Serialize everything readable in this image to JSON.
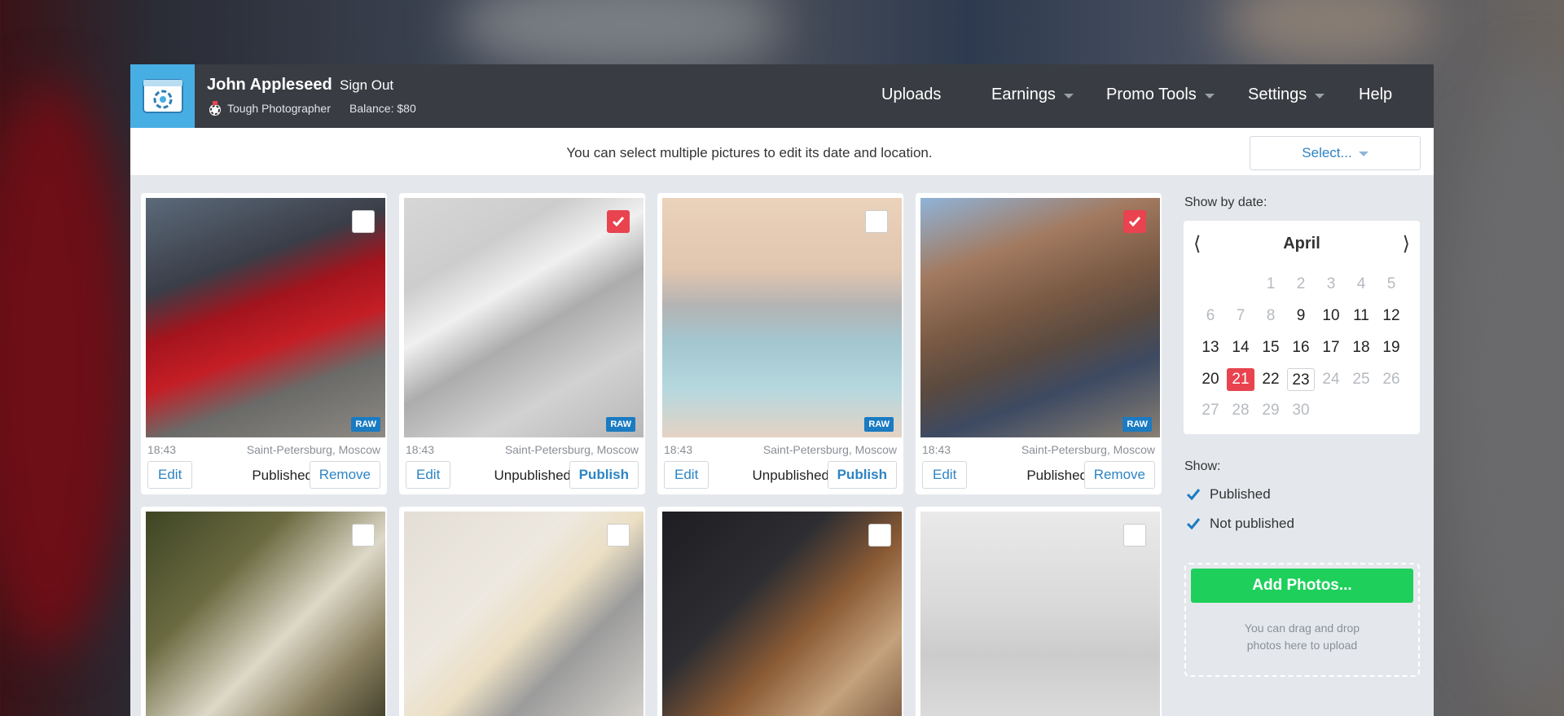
{
  "header": {
    "user_name": "John Appleseed",
    "sign_out": "Sign Out",
    "role": "Tough Photographer",
    "balance": "Balance: $80",
    "nav": [
      "Uploads",
      "Earnings",
      "Promo Tools",
      "Settings",
      "Help"
    ]
  },
  "info_text": "You can select multiple pictures to edit its date and location.",
  "select_label": "Select...",
  "raw_label": "RAW",
  "photos": [
    {
      "time": "18:43",
      "location": "Saint-Petersburg, Moscow",
      "edit": "Edit",
      "status": "Published",
      "action": "Remove",
      "checked": false,
      "dimmed": false
    },
    {
      "time": "18:43",
      "location": "Saint-Petersburg, Moscow",
      "edit": "Edit",
      "status": "Unpublished",
      "action": "Publish",
      "checked": true,
      "dimmed": true
    },
    {
      "time": "18:43",
      "location": "Saint-Petersburg, Moscow",
      "edit": "Edit",
      "status": "Unpublished",
      "action": "Publish",
      "checked": false,
      "dimmed": true
    },
    {
      "time": "18:43",
      "location": "Saint-Petersburg, Moscow",
      "edit": "Edit",
      "status": "Published",
      "action": "Remove",
      "checked": true,
      "dimmed": false
    }
  ],
  "sidebar": {
    "show_by_date": "Show by date:",
    "month": "April",
    "calendar_rows": [
      [
        "",
        "",
        "1",
        "2",
        "3",
        "4",
        "5"
      ],
      [
        "6",
        "7",
        "8",
        "9",
        "10",
        "11",
        "12"
      ],
      [
        "13",
        "14",
        "15",
        "16",
        "17",
        "18",
        "19"
      ],
      [
        "20",
        "21",
        "22",
        "23",
        "24",
        "25",
        "26"
      ],
      [
        "27",
        "28",
        "29",
        "30",
        "",
        "",
        ""
      ]
    ],
    "selected_day": "21",
    "today_day": "23",
    "show_label": "Show:",
    "show_published": "Published",
    "show_not_published": "Not published",
    "add_photos": "Add Photos...",
    "drop_hint_line1": "You can drag and drop",
    "drop_hint_line2": "photos here to upload"
  },
  "colors": {
    "accent_red": "#e8434f",
    "link_blue": "#2d84c4",
    "green": "#1ed05b",
    "header_bg": "#393c42",
    "logo_bg": "#47aee4"
  }
}
